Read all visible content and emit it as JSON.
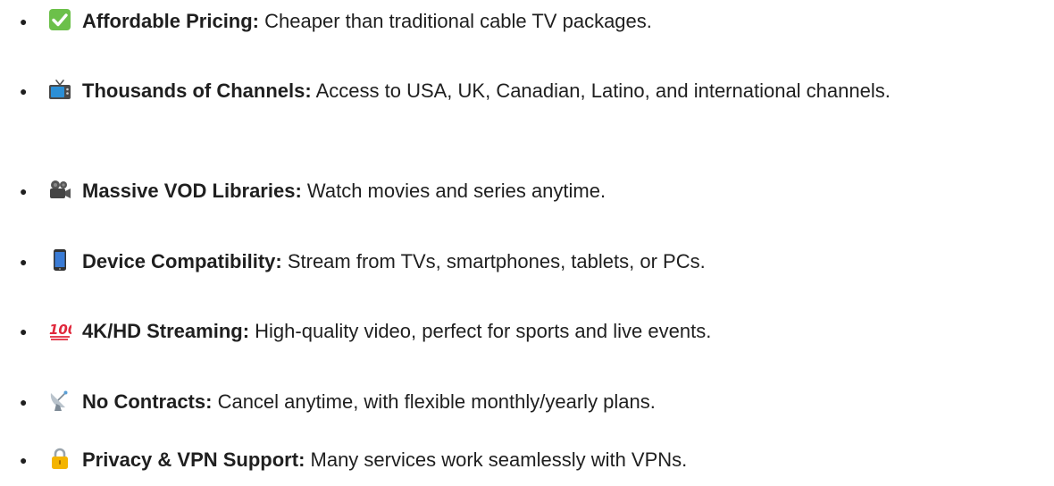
{
  "features": [
    {
      "icon": "check-mark-button-icon",
      "title": "Affordable Pricing:",
      "description": " Cheaper than traditional cable TV packages."
    },
    {
      "icon": "television-icon",
      "title": "Thousands of Channels:",
      "description": " Access to USA, UK, Canadian, Latino, and international channels."
    },
    {
      "icon": "movie-camera-icon",
      "title": "Massive VOD Libraries:",
      "description": " Watch movies and series anytime."
    },
    {
      "icon": "mobile-phone-icon",
      "title": "Device Compatibility:",
      "description": " Stream from TVs, smartphones, tablets, or PCs."
    },
    {
      "icon": "hundred-points-icon",
      "title": "4K/HD Streaming:",
      "description": " High-quality video, perfect for sports and live events."
    },
    {
      "icon": "satellite-antenna-icon",
      "title": "No Contracts:",
      "description": " Cancel anytime, with flexible monthly/yearly plans."
    },
    {
      "icon": "lock-icon",
      "title": "Privacy & VPN Support:",
      "description": " Many services work seamlessly with VPNs."
    }
  ],
  "bullet_char": "●"
}
